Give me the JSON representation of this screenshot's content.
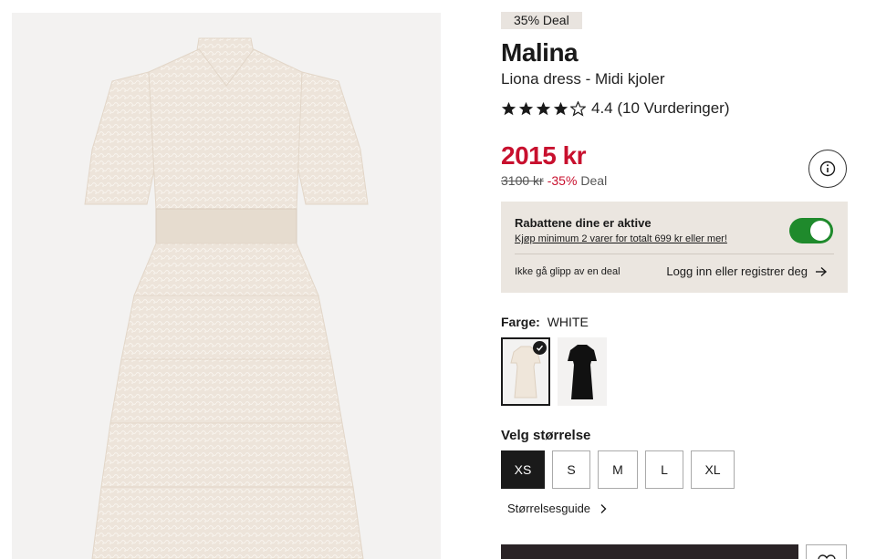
{
  "product": {
    "deal_badge": "35% Deal",
    "brand": "Malina",
    "subtitle": "Liona dress - Midi kjoler",
    "rating_value": 4.4,
    "rating_text": "4.4 (10 Vurderinger)",
    "price": "2015 kr",
    "original_price": "3100 kr",
    "discount": "-35%",
    "deal_label": "Deal"
  },
  "promo": {
    "title": "Rabattene dine er aktive",
    "subtitle": "Kjøp minimum 2 varer for totalt 699 kr eller mer!",
    "toggle_on": true,
    "miss_text": "Ikke gå glipp av en deal",
    "login_link": "Logg inn eller registrer deg"
  },
  "color": {
    "label": "Farge:",
    "value": "WHITE",
    "options": [
      "white-dress-swatch",
      "black-dress-swatch"
    ]
  },
  "size": {
    "label": "Velg størrelse",
    "options": [
      "XS",
      "S",
      "M",
      "L",
      "XL"
    ],
    "selected": "XS",
    "guide": "Størrelsesguide"
  },
  "colors": {
    "price_red": "#c8102e",
    "toggle_green": "#1f8a2c",
    "promo_bg": "#ebe6e0",
    "dark": "#1a1a1a"
  },
  "icons": [
    "info-icon",
    "arrow-right-icon",
    "chevron-right-icon",
    "check-icon",
    "star-icon",
    "heart-icon"
  ]
}
